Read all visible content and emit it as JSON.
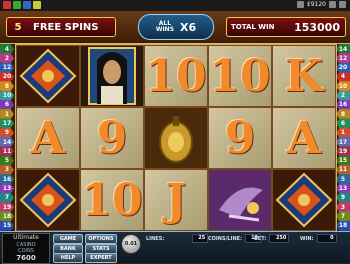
{
  "sysbar": {
    "balance": "£9120"
  },
  "header": {
    "free_spins_count": "5",
    "free_spins_label": "FREE SPINS",
    "all_wins_line1": "ALL",
    "all_wins_line2": "WINS",
    "multiplier": "X6",
    "total_win_label": "TOTAL WIN",
    "total_win_value": "153000"
  },
  "paylines": {
    "left": [
      "4",
      "2",
      "12",
      "20",
      "8",
      "10",
      "6",
      "1",
      "17",
      "9",
      "14",
      "11",
      "5",
      "3",
      "16",
      "13",
      "7",
      "19",
      "18",
      "15"
    ],
    "right": [
      "14",
      "12",
      "20",
      "4",
      "10",
      "2",
      "16",
      "8",
      "6",
      "1",
      "17",
      "19",
      "15",
      "11",
      "5",
      "13",
      "9",
      "3",
      "7",
      "18"
    ]
  },
  "reels": [
    [
      "cleopatra-scarab",
      "A",
      "cleopatra-scarab"
    ],
    [
      "cleopatra-queen",
      "9",
      "10"
    ],
    [
      "10",
      "golden-scarab",
      "J"
    ],
    [
      "10",
      "9",
      "golden-bird"
    ],
    [
      "K",
      "A",
      "cleopatra-scarab"
    ]
  ],
  "bottom": {
    "logo_line1": "Ultimate",
    "logo_line2": "CASINO",
    "coins_label": "COINS",
    "coins_value": "7600",
    "buttons": [
      "GAME",
      "OPTIONS",
      "BANK",
      "STATS",
      "HELP",
      "EXPERT"
    ],
    "coin_size": "0.01",
    "lines_label": "LINES:",
    "lines_value": "25",
    "coins_line_label": "COINS/LINE:",
    "coins_line_value": "10",
    "bet_label": "BET:",
    "bet_value": "250",
    "win_label": "WIN:",
    "win_value": "0"
  },
  "colors": {
    "accent_gold": "#f0c85a",
    "letter_orange": "#f08a2a",
    "panel_blue": "#225e8c"
  }
}
